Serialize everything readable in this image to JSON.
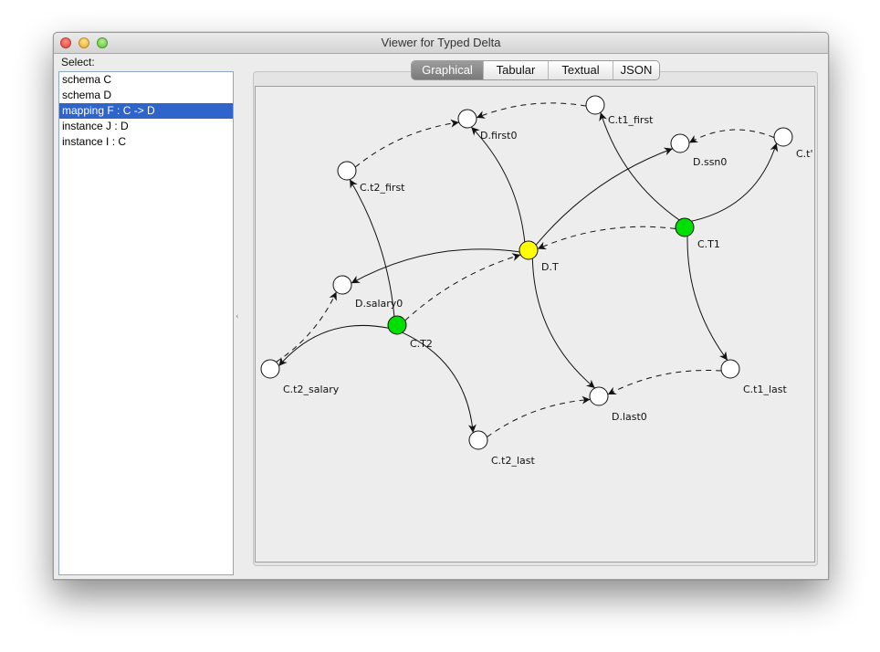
{
  "window": {
    "title": "Viewer for Typed Delta"
  },
  "sidebar": {
    "label": "Select:",
    "items": [
      {
        "label": "schema C",
        "selected": false
      },
      {
        "label": "schema D",
        "selected": false
      },
      {
        "label": "mapping F : C -> D",
        "selected": true
      },
      {
        "label": "instance J : D",
        "selected": false
      },
      {
        "label": "instance I : C",
        "selected": false
      }
    ]
  },
  "tabs": [
    {
      "label": "Graphical",
      "active": true
    },
    {
      "label": "Tabular",
      "active": false
    },
    {
      "label": "Textual",
      "active": false
    },
    {
      "label": "JSON",
      "active": false
    }
  ],
  "colors": {
    "selection": "#2f65ca",
    "node_entity_source": "#00e000",
    "node_entity_target": "#ffff00",
    "node_attribute": "#ffffff"
  },
  "graph": {
    "nodes": [
      {
        "id": "C.t1_first",
        "label": "C.t1_first",
        "kind": "attribute"
      },
      {
        "id": "D.first0",
        "label": "D.first0",
        "kind": "attribute"
      },
      {
        "id": "D.ssn0",
        "label": "D.ssn0",
        "kind": "attribute"
      },
      {
        "id": "C.t1_ssn",
        "label": "C.t'",
        "kind": "attribute"
      },
      {
        "id": "C.t2_first",
        "label": "C.t2_first",
        "kind": "attribute"
      },
      {
        "id": "C.T1",
        "label": "C.T1",
        "kind": "entity-source"
      },
      {
        "id": "D.T",
        "label": "D.T",
        "kind": "entity-target"
      },
      {
        "id": "D.salary0",
        "label": "D.salary0",
        "kind": "attribute"
      },
      {
        "id": "C.T2",
        "label": "C.T2",
        "kind": "entity-source"
      },
      {
        "id": "C.t2_salary",
        "label": "C.t2_salary",
        "kind": "attribute"
      },
      {
        "id": "C.t1_last",
        "label": "C.t1_last",
        "kind": "attribute"
      },
      {
        "id": "D.last0",
        "label": "D.last0",
        "kind": "attribute"
      },
      {
        "id": "C.t2_last",
        "label": "C.t2_last",
        "kind": "attribute"
      }
    ],
    "edges": [
      {
        "from": "C.T1",
        "to": "C.t1_first",
        "style": "solid"
      },
      {
        "from": "C.T1",
        "to": "C.t1_ssn",
        "style": "solid"
      },
      {
        "from": "C.T1",
        "to": "C.t1_last",
        "style": "solid"
      },
      {
        "from": "C.T2",
        "to": "C.t2_first",
        "style": "solid"
      },
      {
        "from": "C.T2",
        "to": "C.t2_salary",
        "style": "solid"
      },
      {
        "from": "C.T2",
        "to": "C.t2_last",
        "style": "solid"
      },
      {
        "from": "D.T",
        "to": "D.first0",
        "style": "solid"
      },
      {
        "from": "D.T",
        "to": "D.ssn0",
        "style": "solid"
      },
      {
        "from": "D.T",
        "to": "D.salary0",
        "style": "solid"
      },
      {
        "from": "D.T",
        "to": "D.last0",
        "style": "solid"
      },
      {
        "from": "C.T1",
        "to": "D.T",
        "style": "dashed"
      },
      {
        "from": "C.T2",
        "to": "D.T",
        "style": "dashed"
      },
      {
        "from": "C.t1_first",
        "to": "D.first0",
        "style": "dashed"
      },
      {
        "from": "C.t2_first",
        "to": "D.first0",
        "style": "dashed"
      },
      {
        "from": "C.t1_ssn",
        "to": "D.ssn0",
        "style": "dashed"
      },
      {
        "from": "C.t2_salary",
        "to": "D.salary0",
        "style": "dashed"
      },
      {
        "from": "C.t1_last",
        "to": "D.last0",
        "style": "dashed"
      },
      {
        "from": "C.t2_last",
        "to": "D.last0",
        "style": "dashed"
      }
    ]
  }
}
